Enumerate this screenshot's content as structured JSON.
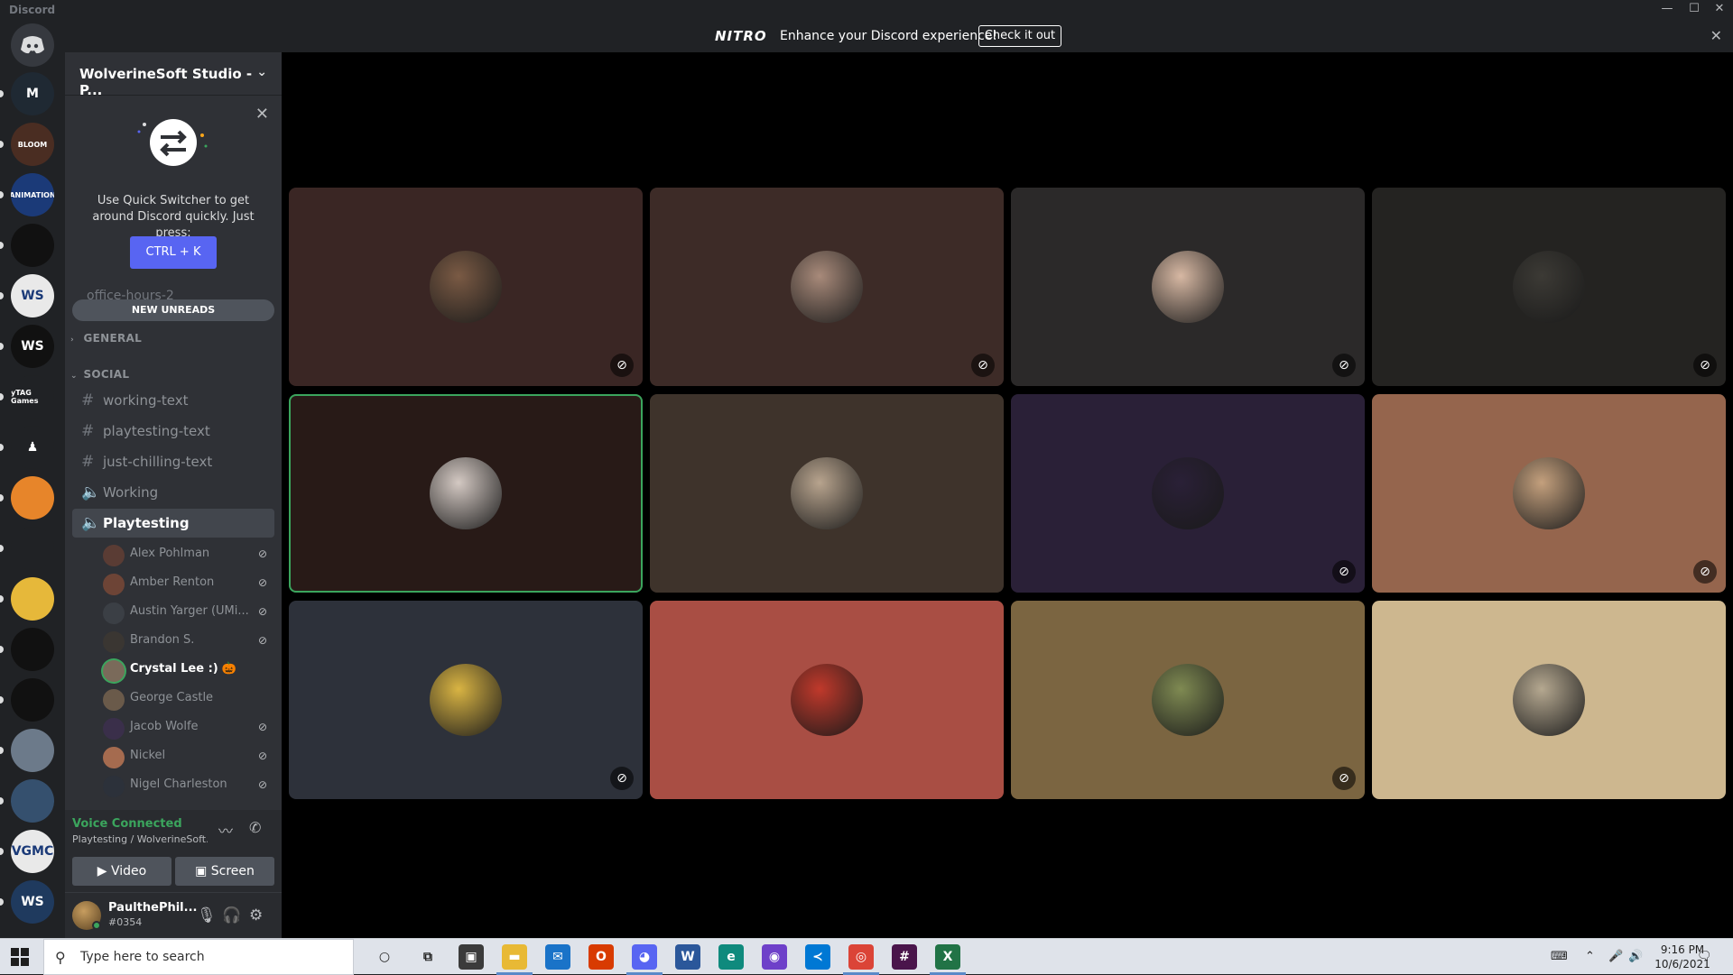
{
  "window": {
    "app_name": "Discord",
    "minimize": "—",
    "maximize": "☐",
    "close": "✕"
  },
  "nitro_banner": {
    "logo": "NITRO",
    "message": "Enhance your Discord experience!",
    "cta": "Check it out",
    "dismiss": "✕"
  },
  "server_rail": {
    "home_icon": "discord-logo-icon",
    "servers": [
      {
        "name": "server-m",
        "label": "M",
        "color": "#1f2933"
      },
      {
        "name": "server-bloom",
        "label": "BLOOM",
        "color": "#4a2d22"
      },
      {
        "name": "server-michigan-animation",
        "label": "ANIMATION",
        "color": "#1b3a78"
      },
      {
        "name": "server-paint",
        "label": "",
        "color": "#111111"
      },
      {
        "name": "server-wolverinesoft-1",
        "label": "WS",
        "color": "#e9e9e9"
      },
      {
        "name": "server-wolverinesoft-2",
        "label": "WS",
        "color": "#111111"
      },
      {
        "name": "server-ytag",
        "label": "yTAG Games",
        "color": "#202225"
      },
      {
        "name": "server-chess",
        "label": "♟",
        "color": "#202225"
      },
      {
        "name": "server-fire",
        "label": "",
        "color": "#e7852a"
      },
      {
        "name": "server-orange",
        "label": "",
        "color": "#202225"
      },
      {
        "name": "server-yellow",
        "label": "",
        "color": "#e6b83a"
      },
      {
        "name": "server-pixel",
        "label": "",
        "color": "#111111"
      },
      {
        "name": "server-book",
        "label": "",
        "color": "#111111"
      },
      {
        "name": "server-truck",
        "label": "",
        "color": "#6c7a8a"
      },
      {
        "name": "server-landscape",
        "label": "",
        "color": "#35506e"
      },
      {
        "name": "server-vgmc",
        "label": "VGMC",
        "color": "#e9e9e9"
      },
      {
        "name": "server-ws-blue",
        "label": "WS",
        "color": "#1f3a5e"
      }
    ]
  },
  "sidebar": {
    "guild_name": "WolverineSoft Studio - P...",
    "chevron": "⌄",
    "quick_switcher": {
      "close": "✕",
      "text": "Use Quick Switcher to get around Discord quickly. Just press:",
      "shortcut": "CTRL + K"
    },
    "clipped_channel": "office-hours-2",
    "new_unreads": "NEW UNREADS",
    "categories": [
      {
        "arrow": "›",
        "label": "GENERAL"
      },
      {
        "arrow": "⌄",
        "label": "SOCIAL"
      }
    ],
    "channels": [
      {
        "type": "text",
        "icon": "#",
        "label": "working-text"
      },
      {
        "type": "text",
        "icon": "#",
        "label": "playtesting-text"
      },
      {
        "type": "text",
        "icon": "#",
        "label": "just-chilling-text"
      },
      {
        "type": "voice",
        "icon": "🔈",
        "label": "Working"
      },
      {
        "type": "voice",
        "icon": "🔈",
        "label": "Playtesting"
      }
    ],
    "voice_users": [
      {
        "name": "Alex Pohlman",
        "muted": true,
        "color": "#5a3c34"
      },
      {
        "name": "Amber Renton",
        "muted": true,
        "color": "#6d4436"
      },
      {
        "name": "Austin Yarger (UMi...",
        "muted": true,
        "color": "#3b3f45"
      },
      {
        "name": "Brandon S.",
        "muted": true,
        "color": "#3a3632"
      },
      {
        "name": "Crystal Lee :)",
        "muted": false,
        "color": "#7a6a5a",
        "badge": "🎃"
      },
      {
        "name": "George Castle",
        "muted": false,
        "color": "#6a5a4a"
      },
      {
        "name": "Jacob Wolfe",
        "muted": true,
        "color": "#3a2f4a"
      },
      {
        "name": "Nickel",
        "muted": true,
        "color": "#a56b4f"
      },
      {
        "name": "Nigel Charleston",
        "muted": true,
        "color": "#2c313a"
      }
    ],
    "voice_panel": {
      "status": "Voice Connected",
      "location": "Playtesting / WolverineSoft...",
      "video_label": "Video",
      "screen_label": "Screen"
    },
    "user_panel": {
      "name": "PaulthePhil...",
      "tag": "#0354"
    }
  },
  "video_grid": {
    "tiles": [
      {
        "bg": "#3a2624",
        "avatar": "#7a5a44",
        "muted": true,
        "active": false
      },
      {
        "bg": "#3d2b27",
        "avatar": "#a88a7a",
        "muted": true,
        "active": false
      },
      {
        "bg": "#2b2929",
        "avatar": "#d7b8a3",
        "muted": true,
        "active": false
      },
      {
        "bg": "#242321",
        "avatar": "#3c3a35",
        "muted": true,
        "active": false
      },
      {
        "bg": "#281a17",
        "avatar": "#d4c9c3",
        "muted": false,
        "active": true
      },
      {
        "bg": "#3e332b",
        "avatar": "#b8a48e",
        "muted": false,
        "active": false
      },
      {
        "bg": "#2a2037",
        "avatar": "#2a2037",
        "muted": true,
        "active": false
      },
      {
        "bg": "#95654d",
        "avatar": "#c4a07d",
        "muted": true,
        "active": false
      },
      {
        "bg": "#2d313a",
        "avatar": "#d9b443",
        "muted": true,
        "active": false
      },
      {
        "bg": "#a94e44",
        "avatar": "#c0392b",
        "muted": false,
        "active": false
      },
      {
        "bg": "#7b6541",
        "avatar": "#7f8a52",
        "muted": true,
        "active": false
      },
      {
        "bg": "#cdb78f",
        "avatar": "#b5a890",
        "muted": false,
        "active": false
      }
    ]
  },
  "taskbar": {
    "search_placeholder": "Type here to search",
    "apps": [
      {
        "name": "cortana",
        "label": "○",
        "color": "#dfe3ea"
      },
      {
        "name": "task-view",
        "label": "⧉",
        "color": "#dfe3ea"
      },
      {
        "name": "store",
        "label": "▣",
        "color": "#3b3b3b"
      },
      {
        "name": "file-explorer",
        "label": "▬",
        "color": "#e8b935"
      },
      {
        "name": "mail",
        "label": "✉",
        "color": "#1a73c8"
      },
      {
        "name": "office",
        "label": "O",
        "color": "#d83b01"
      },
      {
        "name": "discord",
        "label": "◕",
        "color": "#5865f2"
      },
      {
        "name": "word",
        "label": "W",
        "color": "#2b579a"
      },
      {
        "name": "edge",
        "label": "e",
        "color": "#0f8a7d"
      },
      {
        "name": "github",
        "label": "◉",
        "color": "#6e40c9"
      },
      {
        "name": "vscode",
        "label": "≺",
        "color": "#0078d4"
      },
      {
        "name": "chrome",
        "label": "◎",
        "color": "#db4437"
      },
      {
        "name": "slack",
        "label": "#",
        "color": "#4a154b"
      },
      {
        "name": "excel",
        "label": "X",
        "color": "#217346"
      }
    ],
    "time": "9:16 PM",
    "date": "10/6/2021"
  }
}
